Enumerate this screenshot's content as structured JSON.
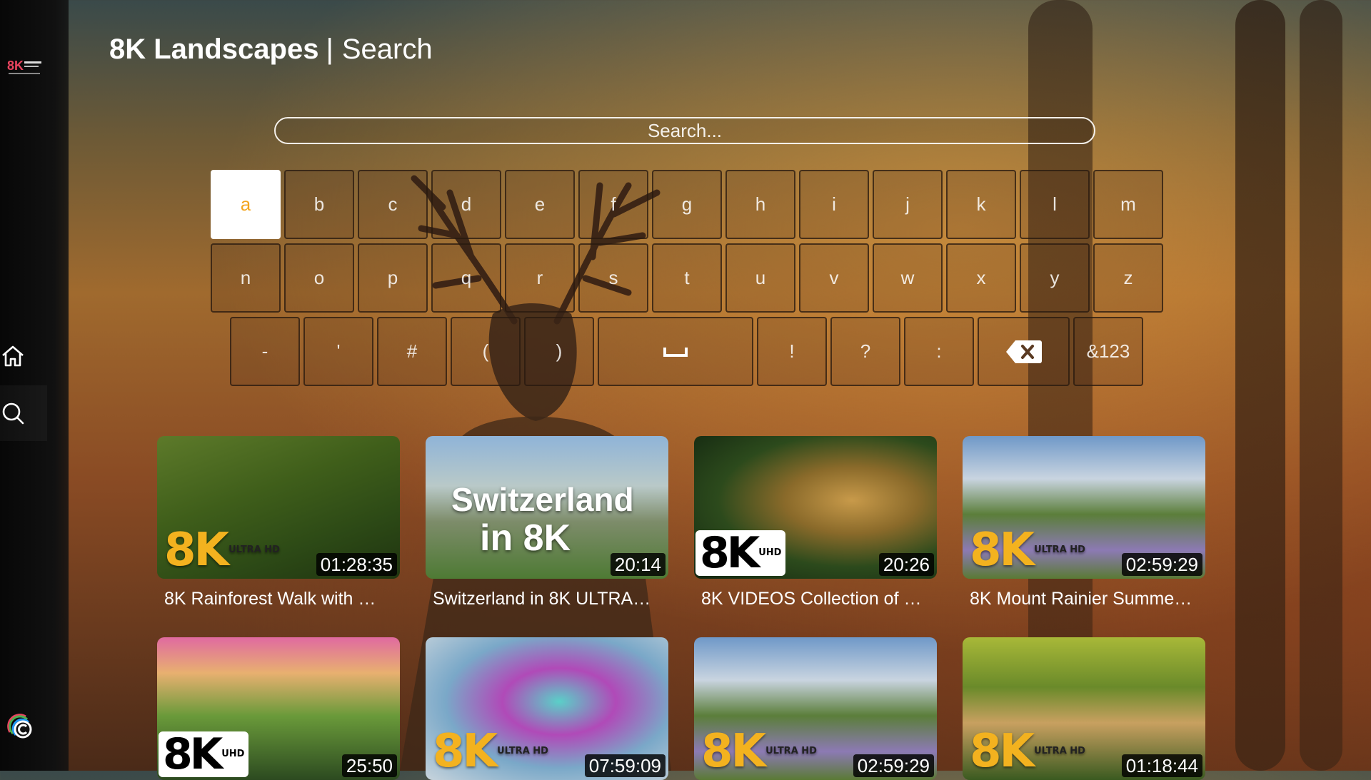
{
  "header": {
    "app_name": "8K Landscapes",
    "separator": "|",
    "section": "Search"
  },
  "search": {
    "placeholder": "Search..."
  },
  "keyboard": {
    "row1": [
      "a",
      "b",
      "c",
      "d",
      "e",
      "f",
      "g",
      "h",
      "i",
      "j",
      "k",
      "l",
      "m"
    ],
    "row2": [
      "n",
      "o",
      "p",
      "q",
      "r",
      "s",
      "t",
      "u",
      "v",
      "w",
      "x",
      "y",
      "z"
    ],
    "row3": [
      "-",
      "'",
      "#",
      "(",
      ")",
      "␣",
      "!",
      "?",
      ":",
      "⌫",
      "&123"
    ],
    "focused_key": "a"
  },
  "sidebar": {
    "items": [
      {
        "label": "Home",
        "icon": "home-icon"
      },
      {
        "label": "Search",
        "icon": "search-icon",
        "active": true
      }
    ],
    "accent": "#f3a51f"
  },
  "videos": [
    {
      "title": "8K Rainforest Walk with …",
      "duration": "01:28:35",
      "badge": "8K",
      "badge_sub": "ULTRA HD"
    },
    {
      "title": "Switzerland in 8K ULTRA…",
      "duration": "20:14",
      "overlay_line1": "Switzerland",
      "overlay_line2": "in 8K"
    },
    {
      "title": "8K VIDEOS Collection of …",
      "duration": "20:26",
      "badge": "8K",
      "badge_sub": "UHD"
    },
    {
      "title": "8K Mount Rainier Summe…",
      "duration": "02:59:29",
      "badge": "8K",
      "badge_sub": "ULTRA HD"
    },
    {
      "title": "",
      "duration": "25:50",
      "badge": "8K",
      "badge_sub": "UHD"
    },
    {
      "title": "",
      "duration": "07:59:09",
      "badge": "8K",
      "badge_sub": "ULTRA HD"
    },
    {
      "title": "",
      "duration": "02:59:29",
      "badge": "8K",
      "badge_sub": "ULTRA HD"
    },
    {
      "title": "",
      "duration": "01:18:44",
      "badge": "8K",
      "badge_sub": "ULTRA HD"
    }
  ]
}
